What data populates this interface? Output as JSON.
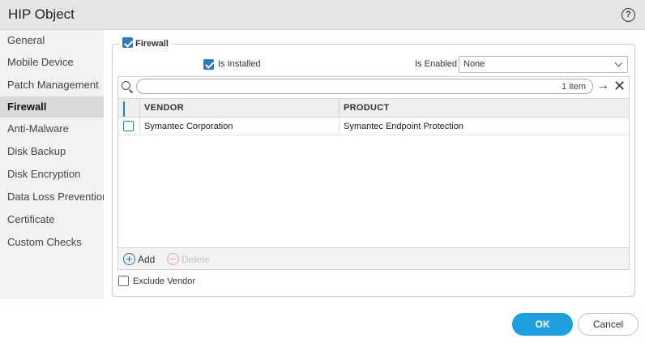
{
  "window": {
    "title": "HIP Object"
  },
  "sidebar": {
    "items": [
      {
        "label": "General",
        "active": false
      },
      {
        "label": "Mobile Device",
        "active": false
      },
      {
        "label": "Patch Management",
        "active": false
      },
      {
        "label": "Firewall",
        "active": true
      },
      {
        "label": "Anti-Malware",
        "active": false
      },
      {
        "label": "Disk Backup",
        "active": false
      },
      {
        "label": "Disk Encryption",
        "active": false
      },
      {
        "label": "Data Loss Prevention",
        "active": false
      },
      {
        "label": "Certificate",
        "active": false
      },
      {
        "label": "Custom Checks",
        "active": false
      }
    ]
  },
  "firewall": {
    "section_label": "Firewall",
    "section_checked": true,
    "is_installed_label": "Is Installed",
    "is_installed_checked": true,
    "is_enabled_label": "Is Enabled",
    "is_enabled_value": "None"
  },
  "table": {
    "search_value": "",
    "item_count": "1 item",
    "columns": {
      "vendor": "VENDOR",
      "product": "PRODUCT"
    },
    "rows": [
      {
        "vendor": "Symantec Corporation",
        "product": "Symantec Endpoint Protection",
        "checked": false
      }
    ],
    "add_label": "Add",
    "delete_label": "Delete"
  },
  "exclude_vendor": {
    "label": "Exclude Vendor",
    "checked": false
  },
  "buttons": {
    "ok": "OK",
    "cancel": "Cancel"
  },
  "colors": {
    "accent": "#1e9fdf",
    "checkbox": "#2a7abf",
    "active_nav": "#d9d9d9"
  },
  "icons": {
    "help": "help-circle-icon",
    "search": "search-icon",
    "go": "arrow-right-icon",
    "clear": "close-icon",
    "dropdown": "chevron-down-icon",
    "add": "plus-circle-icon",
    "delete": "minus-circle-icon"
  }
}
